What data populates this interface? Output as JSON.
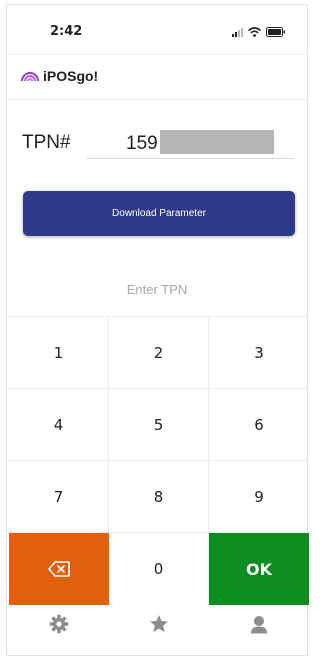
{
  "status_bar": {
    "time": "2:42",
    "icons": [
      "signal-icon",
      "wifi-icon",
      "battery-icon"
    ]
  },
  "header": {
    "logo_text": "iPOSgo!",
    "logo_color": "#8a3fd1"
  },
  "tpn": {
    "label": "TPN#",
    "value": "159"
  },
  "download_button": {
    "label": "Download Parameter",
    "color": "#2e3a8c"
  },
  "keypad": {
    "prompt": "Enter TPN",
    "keys": [
      "1",
      "2",
      "3",
      "4",
      "5",
      "6",
      "7",
      "8",
      "9"
    ],
    "zero": "0",
    "ok_label": "OK",
    "backspace_color": "#e0600e",
    "ok_color": "#0b8d1f"
  },
  "tab_bar": {
    "tabs": [
      "gear-icon",
      "star-icon",
      "user-icon"
    ]
  }
}
